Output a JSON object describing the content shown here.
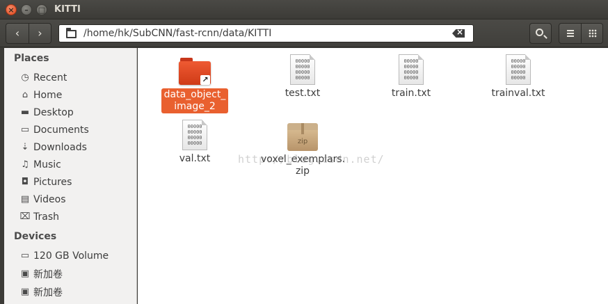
{
  "window": {
    "title": "KITTI",
    "close_glyph": "×",
    "min_glyph": "–",
    "max_glyph": "□"
  },
  "toolbar": {
    "back_glyph": "‹",
    "forward_glyph": "›",
    "path": "/home/hk/SubCNN/fast-rcnn/data/KITTI"
  },
  "sidebar": {
    "places_heading": "Places",
    "places": [
      {
        "label": "Recent",
        "icon": "clock-icon",
        "glyph": "◷"
      },
      {
        "label": "Home",
        "icon": "home-icon",
        "glyph": "⌂"
      },
      {
        "label": "Desktop",
        "icon": "desktop-folder-icon",
        "glyph": "▬"
      },
      {
        "label": "Documents",
        "icon": "documents-icon",
        "glyph": "▭"
      },
      {
        "label": "Downloads",
        "icon": "downloads-icon",
        "glyph": "⇣"
      },
      {
        "label": "Music",
        "icon": "music-icon",
        "glyph": "♫"
      },
      {
        "label": "Pictures",
        "icon": "camera-icon",
        "glyph": "◘"
      },
      {
        "label": "Videos",
        "icon": "film-icon",
        "glyph": "▤"
      },
      {
        "label": "Trash",
        "icon": "trash-icon",
        "glyph": "⌧"
      }
    ],
    "devices_heading": "Devices",
    "devices": [
      {
        "label": "120 GB Volume",
        "icon": "drive-icon",
        "glyph": "▭"
      },
      {
        "label": "新加卷",
        "icon": "drive-icon",
        "glyph": "▣"
      },
      {
        "label": "新加卷",
        "icon": "drive-icon",
        "glyph": "▣"
      }
    ]
  },
  "files": [
    {
      "name": "data_object_\nimage_2",
      "type": "folder-link",
      "selected": true
    },
    {
      "name": "test.txt",
      "type": "text"
    },
    {
      "name": "train.txt",
      "type": "text"
    },
    {
      "name": "trainval.txt",
      "type": "text"
    },
    {
      "name": "val.txt",
      "type": "text"
    },
    {
      "name": "voxel_exemplars.\nzip",
      "type": "zip"
    }
  ],
  "icon_text": {
    "text_file_preview": "00000\n00000\n00000\n00000",
    "zip_label": "zip",
    "link_arrow": "↗"
  },
  "watermark": "http://blog.csdn.net/",
  "colors": {
    "selection": "#e9602f",
    "folder": "#e04a24",
    "titlebar": "#3c3b37"
  }
}
